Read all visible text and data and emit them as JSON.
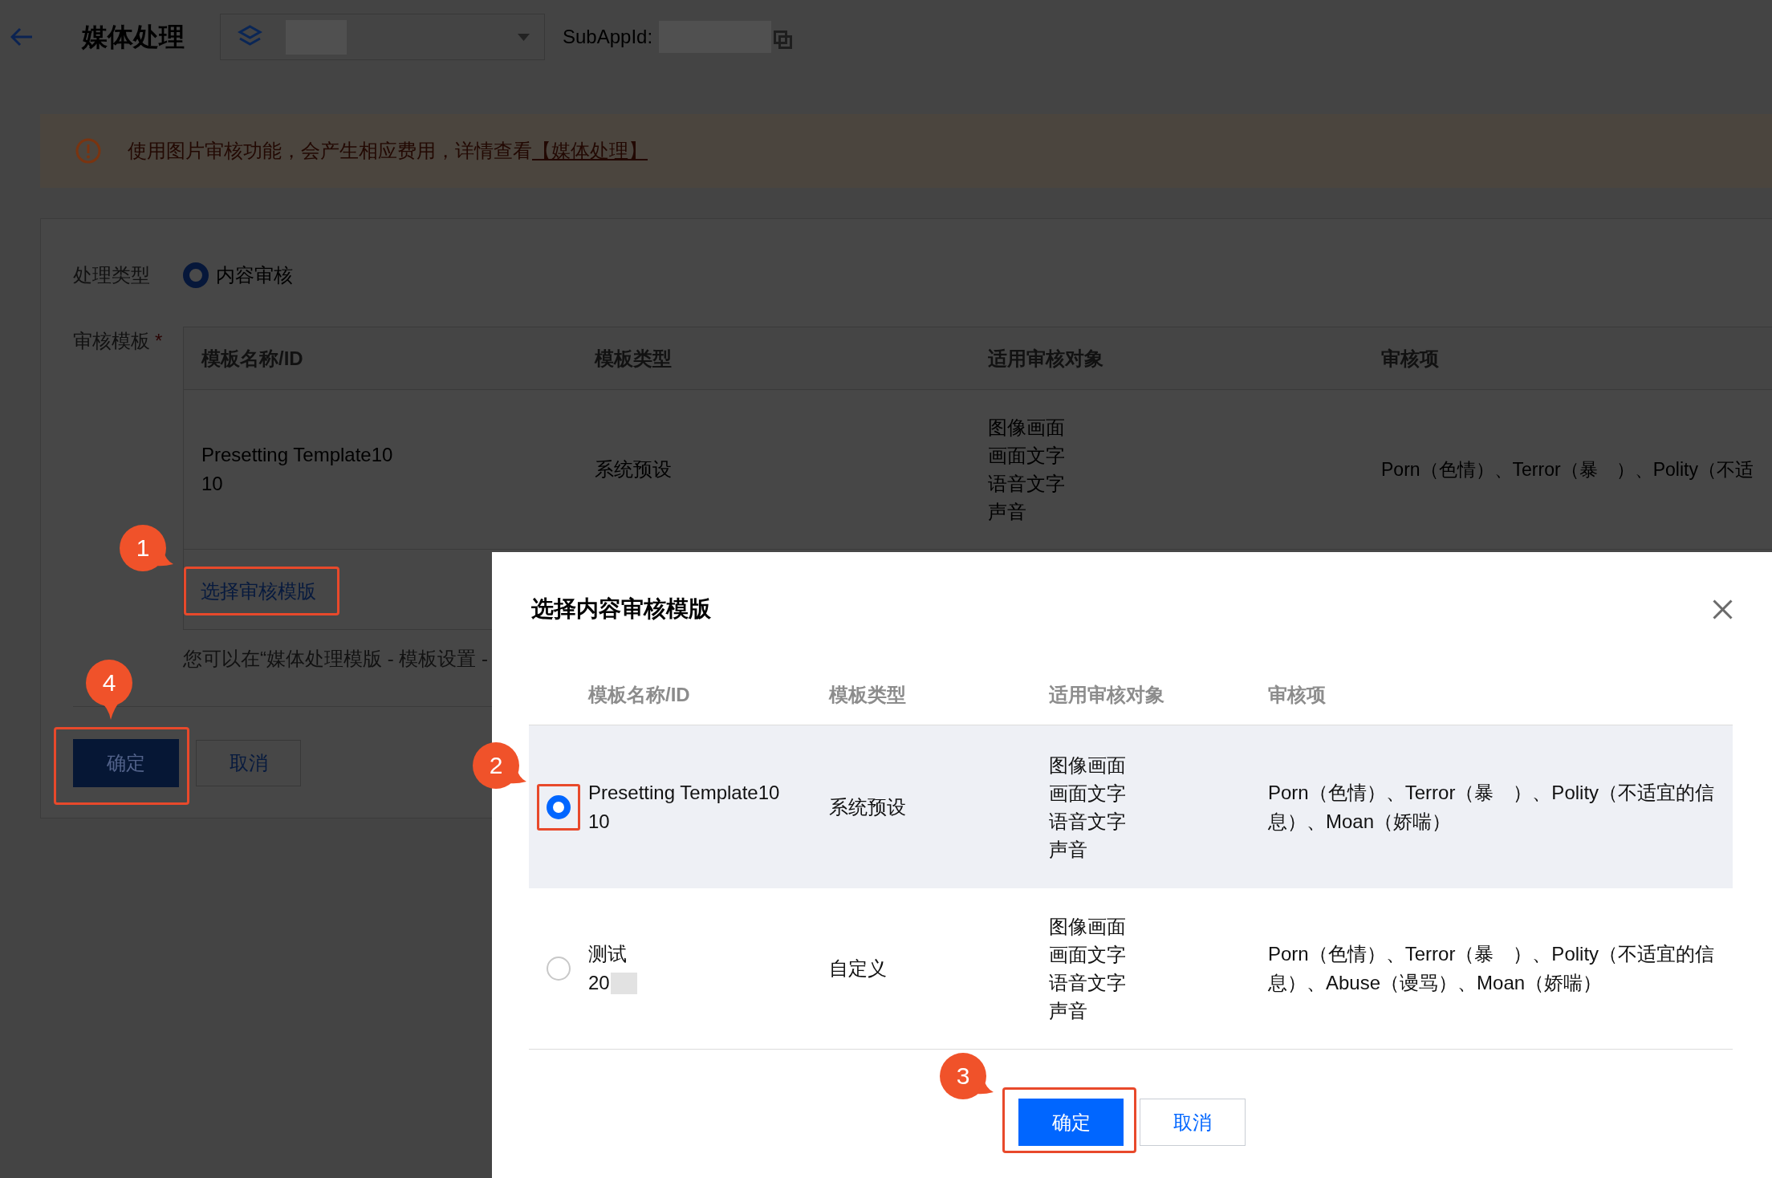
{
  "header": {
    "title": "媒体处理",
    "app_select": {
      "value_redacted": true
    },
    "subappid": {
      "label": "SubAppId:",
      "value_redacted": true
    }
  },
  "notice": {
    "text": "使用图片审核功能，会产生相应费用，详情查看",
    "link": "【媒体处理】"
  },
  "form": {
    "process_type": {
      "label": "处理类型",
      "options": [
        {
          "label": "内容审核",
          "selected": true
        }
      ]
    },
    "template": {
      "label": "审核模板",
      "required_mark": "*",
      "columns": [
        "模板名称/ID",
        "模板类型",
        "适用审核对象",
        "审核项"
      ],
      "rows": [
        {
          "name": "Presetting Template10",
          "id": "10",
          "id_redacted": false,
          "type": "系统预设",
          "objects": [
            "图像画面",
            "画面文字",
            "语音文字",
            "声音"
          ],
          "items": "Porn（色情）、Terror（暴　）、Polity（不适"
        }
      ],
      "select_button": {
        "label": "选择审核模版",
        "callout": "1"
      },
      "hint": "您可以在“媒体处理模版 - 模板设置 -"
    },
    "buttons": [
      {
        "label": "确定",
        "kind": "primary",
        "callout": "4"
      },
      {
        "label": "取消",
        "kind": "secondary"
      }
    ]
  },
  "dialog": {
    "title": "选择内容审核模版",
    "columns": [
      "模板名称/ID",
      "模板类型",
      "适用审核对象",
      "审核项"
    ],
    "rows": [
      {
        "selected": true,
        "callout": "2",
        "name": "Presetting Template10",
        "id": "10",
        "id_redacted": false,
        "type": "系统预设",
        "objects": [
          "图像画面",
          "画面文字",
          "语音文字",
          "声音"
        ],
        "items": "Porn（色情）、Terror（暴　）、Polity（不适宜的信息）、Moan（娇喘）"
      },
      {
        "selected": false,
        "name": "测试",
        "id": "20",
        "id_redacted": true,
        "type": "自定义",
        "objects": [
          "图像画面",
          "画面文字",
          "语音文字",
          "声音"
        ],
        "items": "Porn（色情）、Terror（暴　）、Polity（不适宜的信息）、Abuse（谩骂）、Moan（娇喘）"
      }
    ],
    "buttons": [
      {
        "label": "确定",
        "kind": "primary",
        "callout": "3"
      },
      {
        "label": "取消",
        "kind": "secondary"
      }
    ]
  }
}
